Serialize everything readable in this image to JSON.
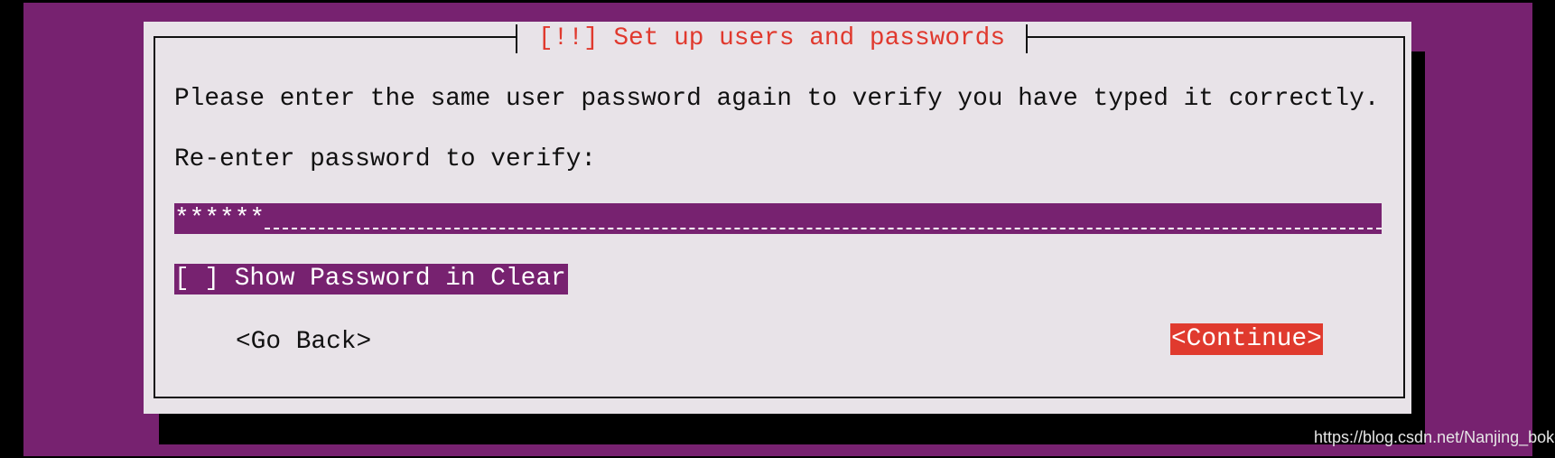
{
  "dialog": {
    "title": "[!!] Set up users and passwords",
    "message": "Please enter the same user password again to verify you have typed it correctly.",
    "prompt": "Re-enter password to verify:",
    "password_value": "******",
    "show_password_checkbox": {
      "label": "[ ] Show Password in Clear",
      "checked": false
    },
    "buttons": {
      "back": "<Go Back>",
      "continue": "<Continue>"
    }
  },
  "watermark": "https://blog.csdn.net/Nanjing_bokebi",
  "colors": {
    "background": "#772270",
    "dialog": "#e8e3e8",
    "accent": "#e03a2e"
  }
}
